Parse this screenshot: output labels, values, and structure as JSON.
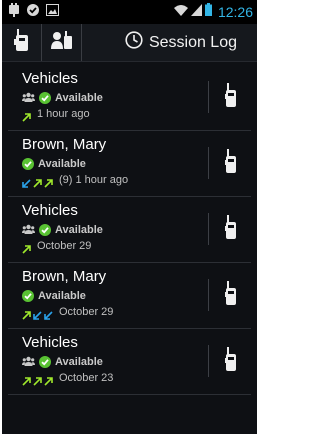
{
  "status_bar": {
    "time": "12:26"
  },
  "action_bar": {
    "session_log_label": "Session Log"
  },
  "colors": {
    "accent_blue": "#33b5e5",
    "green": "#59c233",
    "outgoing_arrow": "#9fe82c",
    "incoming_arrow": "#2aa2ea"
  },
  "items": [
    {
      "name": "Vehicles",
      "group": true,
      "status": "Available",
      "arrows": [
        "out"
      ],
      "count": "",
      "time": "1 hour ago"
    },
    {
      "name": "Brown, Mary",
      "group": false,
      "status": "Available",
      "arrows": [
        "in",
        "out",
        "out"
      ],
      "count": "(9)",
      "time": "1 hour ago"
    },
    {
      "name": "Vehicles",
      "group": true,
      "status": "Available",
      "arrows": [
        "out"
      ],
      "count": "",
      "time": "October 29"
    },
    {
      "name": "Brown, Mary",
      "group": false,
      "status": "Available",
      "arrows": [
        "out",
        "in",
        "in"
      ],
      "count": "",
      "time": "October 29"
    },
    {
      "name": "Vehicles",
      "group": true,
      "status": "Available",
      "arrows": [
        "out",
        "out",
        "out"
      ],
      "count": "",
      "time": "October 23"
    }
  ]
}
